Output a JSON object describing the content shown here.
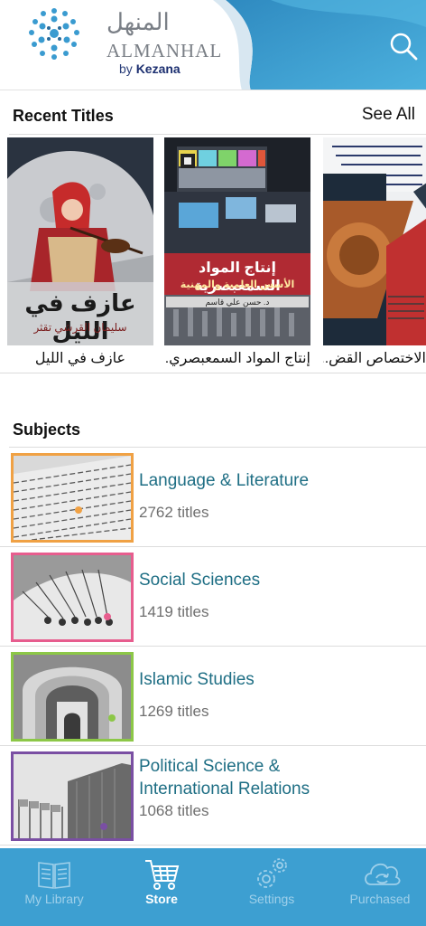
{
  "header": {
    "logo_arabic": "المنهل",
    "logo_latin": "ALMANHAL",
    "logo_by": "by",
    "logo_brand": "Kezana",
    "search_icon": "search-icon",
    "accent_color": "#3d9fd1"
  },
  "recent": {
    "title": "Recent Titles",
    "see_all": "See All",
    "books": [
      {
        "title": "عازف في الليل",
        "cover_title": "عازف في الليل",
        "cover_author": "سليمان القرشي تقثر"
      },
      {
        "title": "إنتاج المواد السمعبصري...",
        "cover_title": "إنتاج المواد السمعبصرية",
        "cover_subtitle": "الأسس العلمية والمهنية",
        "cover_author": "د. حسن علي قاسم"
      },
      {
        "title": "الاختصاص القض..."
      }
    ]
  },
  "subjects": {
    "title": "Subjects",
    "items": [
      {
        "name": "Language & Literature",
        "count": "2762 titles",
        "color": "#f0a144"
      },
      {
        "name": "Social Sciences",
        "count": "1419 titles",
        "color": "#e75d8e"
      },
      {
        "name": "Islamic Studies",
        "count": "1269 titles",
        "color": "#8cc747"
      },
      {
        "name": "Political Science & International Relations",
        "name_line1": "Political Science &",
        "name_line2": "International Relations",
        "count": "1068 titles",
        "color": "#7a4fa3"
      }
    ]
  },
  "tabs": [
    {
      "label": "My Library",
      "icon": "book-icon",
      "active": false
    },
    {
      "label": "Store",
      "icon": "cart-icon",
      "active": true
    },
    {
      "label": "Settings",
      "icon": "gear-icon",
      "active": false
    },
    {
      "label": "Purchased",
      "icon": "cloud-sync-icon",
      "active": false
    }
  ]
}
